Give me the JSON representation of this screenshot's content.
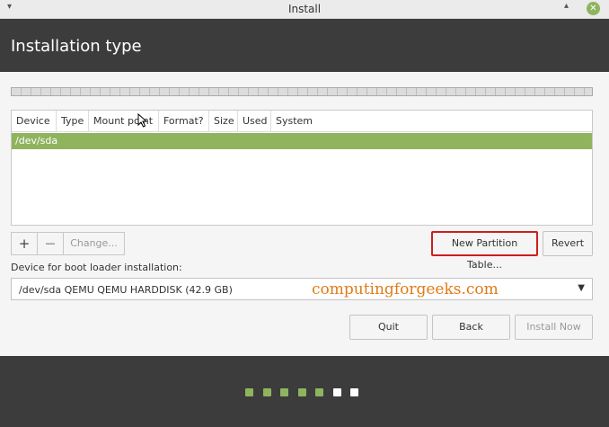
{
  "window": {
    "title": "Install",
    "icons": {
      "menu": "chevron-down-icon",
      "minimize": "chevron-up-icon",
      "close": "close-icon"
    },
    "close_glyph": "✕"
  },
  "header": {
    "title": "Installation type"
  },
  "partition_table": {
    "columns": [
      "Device",
      "Type",
      "Mount point",
      "Format?",
      "Size",
      "Used",
      "System"
    ],
    "rows": [
      {
        "device": "/dev/sda"
      }
    ]
  },
  "toolbar": {
    "add_label": "+",
    "remove_label": "—",
    "change_label": "Change..."
  },
  "actions": {
    "new_table_label": "New Partition Table...",
    "revert_label": "Revert"
  },
  "bootloader": {
    "label": "Device for boot loader installation:",
    "selected": "/dev/sda  QEMU QEMU HARDDISK (42.9 GB)"
  },
  "watermark": "computingforgeeks.com",
  "nav": {
    "quit_label": "Quit",
    "back_label": "Back",
    "install_label": "Install Now"
  },
  "progress": {
    "total_steps": 7,
    "completed_steps": 5
  },
  "colors": {
    "accent": "#8fb45e",
    "highlight_border": "#cc1f1f",
    "header_bg": "#3c3c3c",
    "watermark": "#e07b17"
  }
}
